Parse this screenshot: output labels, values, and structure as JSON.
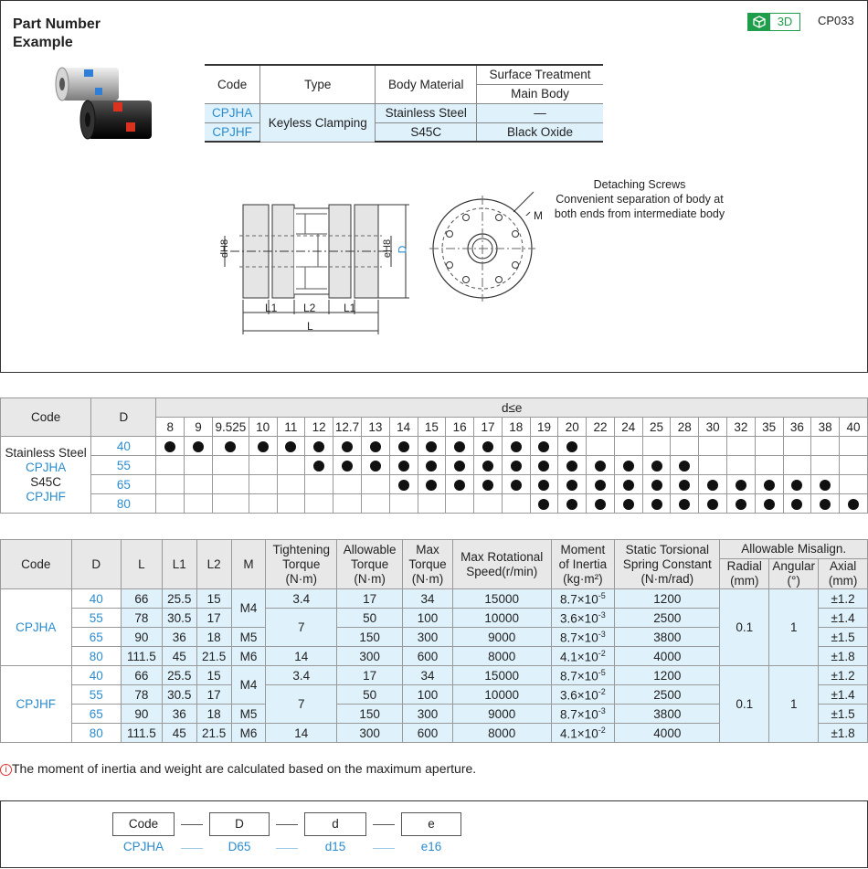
{
  "header": {
    "badge_3d": "3D",
    "page_code": "CP033"
  },
  "material_table": {
    "headers": {
      "code": "Code",
      "type": "Type",
      "body_material": "Body Material",
      "surface_treatment": "Surface Treatment",
      "main_body": "Main Body"
    },
    "rows": [
      {
        "code": "CPJHA",
        "type": "Keyless Clamping",
        "material": "Stainless Steel",
        "surface": "—"
      },
      {
        "code": "CPJHF",
        "type": "Keyless Clamping",
        "material": "S45C",
        "surface": "Black Oxide"
      }
    ]
  },
  "drawing": {
    "note_title": "Detaching Screws",
    "note_line1": "Convenient separation of body at",
    "note_line2": "both ends from intermediate body",
    "labels": {
      "m": "M",
      "d": "dH8",
      "e": "eH8",
      "D": "D",
      "L1a": "L1",
      "L2": "L2",
      "L1b": "L1",
      "L": "L"
    }
  },
  "d_table": {
    "code_header": "Code",
    "D_header": "D",
    "group_header": "d≤e",
    "d_values": [
      "8",
      "9",
      "9.525",
      "10",
      "11",
      "12",
      "12.7",
      "13",
      "14",
      "15",
      "16",
      "17",
      "18",
      "19",
      "20",
      "22",
      "24",
      "25",
      "28",
      "30",
      "32",
      "35",
      "36",
      "38",
      "40"
    ],
    "code_lines": [
      "Stainless Steel",
      "CPJHA",
      "S45C",
      "CPJHF"
    ],
    "rows": [
      {
        "D": "40",
        "from": 0,
        "to": 14
      },
      {
        "D": "55",
        "from": 5,
        "to": 18
      },
      {
        "D": "65",
        "from": 8,
        "to": 23
      },
      {
        "D": "80",
        "from": 13,
        "to": 24
      }
    ]
  },
  "spec_table": {
    "headers": {
      "code": "Code",
      "D": "D",
      "L": "L",
      "L1": "L1",
      "L2": "L2",
      "M": "M",
      "tt1": "Tightening",
      "tt2": "Torque",
      "tt3": "(N·m)",
      "at1": "Allowable",
      "at2": "Torque",
      "at3": "(N·m)",
      "mt1": "Max",
      "mt2": "Torque",
      "mt3": "(N·m)",
      "rs1": "Max Rotational",
      "rs2": "Speed(r/min)",
      "mi1": "Moment",
      "mi2": "of Inertia",
      "mi3": "(kg·m²)",
      "st1": "Static Torsional",
      "st2": "Spring Constant",
      "st3": "(N·m/rad)",
      "mis": "Allowable Misalign.",
      "rad1": "Radial",
      "rad2": "(mm)",
      "ang1": "Angular",
      "ang2": "(°)",
      "ax1": "Axial",
      "ax2": "(mm)"
    },
    "groups": [
      {
        "code": "CPJHA",
        "radial": "0.1",
        "angular": "1",
        "rows": [
          {
            "D": "40",
            "L": "66",
            "L1": "25.5",
            "L2": "15",
            "allow": "17",
            "max": "34",
            "speed": "15000",
            "mi": "8.7×10",
            "mi_exp": "-5",
            "spring": "1200",
            "axial": "±1.2"
          },
          {
            "D": "55",
            "L": "78",
            "L1": "30.5",
            "L2": "17",
            "allow": "50",
            "max": "100",
            "speed": "10000",
            "mi": "3.6×10",
            "mi_exp": "-3",
            "spring": "2500",
            "axial": "±1.4"
          },
          {
            "D": "65",
            "L": "90",
            "L1": "36",
            "L2": "18",
            "allow": "150",
            "max": "300",
            "speed": "9000",
            "mi": "8.7×10",
            "mi_exp": "-3",
            "spring": "3800",
            "axial": "±1.5"
          },
          {
            "D": "80",
            "L": "111.5",
            "L1": "45",
            "L2": "21.5",
            "allow": "300",
            "max": "600",
            "speed": "8000",
            "mi": "4.1×10",
            "mi_exp": "-2",
            "spring": "4000",
            "axial": "±1.8"
          }
        ],
        "m": [
          "M4",
          "M5",
          "M6"
        ],
        "tight": [
          "3.4",
          "7",
          "14"
        ]
      },
      {
        "code": "CPJHF",
        "radial": "0.1",
        "angular": "1",
        "rows": [
          {
            "D": "40",
            "L": "66",
            "L1": "25.5",
            "L2": "15",
            "allow": "17",
            "max": "34",
            "speed": "15000",
            "mi": "8.7×10",
            "mi_exp": "-5",
            "spring": "1200",
            "axial": "±1.2"
          },
          {
            "D": "55",
            "L": "78",
            "L1": "30.5",
            "L2": "17",
            "allow": "50",
            "max": "100",
            "speed": "10000",
            "mi": "3.6×10",
            "mi_exp": "-2",
            "spring": "2500",
            "axial": "±1.4"
          },
          {
            "D": "65",
            "L": "90",
            "L1": "36",
            "L2": "18",
            "allow": "150",
            "max": "300",
            "speed": "9000",
            "mi": "8.7×10",
            "mi_exp": "-3",
            "spring": "3800",
            "axial": "±1.5"
          },
          {
            "D": "80",
            "L": "111.5",
            "L1": "45",
            "L2": "21.5",
            "allow": "300",
            "max": "600",
            "speed": "8000",
            "mi": "4.1×10",
            "mi_exp": "-2",
            "spring": "4000",
            "axial": "±1.8"
          }
        ],
        "m": [
          "M4",
          "M5",
          "M6"
        ],
        "tight": [
          "3.4",
          "7",
          "14"
        ]
      }
    ]
  },
  "footnote": {
    "icon": "i",
    "text": "The moment of inertia and weight are calculated based on the maximum aperture."
  },
  "part_number": {
    "title_line1": "Part Number",
    "title_line2": "Example",
    "boxes": [
      "Code",
      "D",
      "d",
      "e"
    ],
    "values": [
      "CPJHA",
      "D65",
      "d15",
      "e16"
    ]
  },
  "colors": {
    "accent_blue": "#2a8ccf",
    "light_blue_fill": "#dff1fb",
    "badge_green": "#1e9e4a",
    "coupling_red": "#d9331f"
  }
}
